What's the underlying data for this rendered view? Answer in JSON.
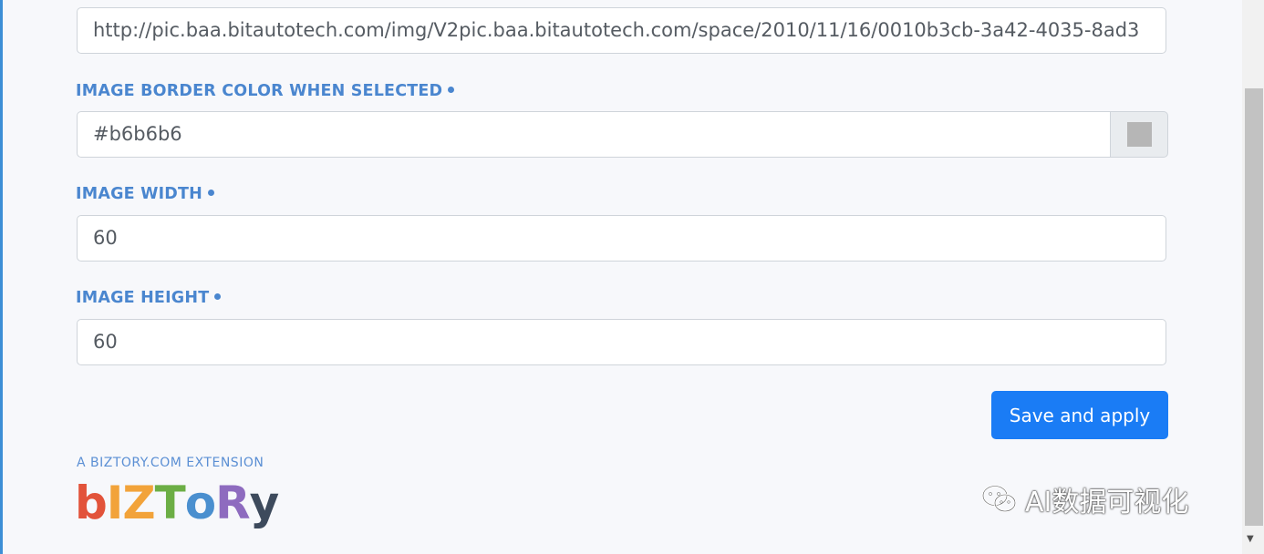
{
  "form": {
    "image_url": {
      "value": "http://pic.baa.bitautotech.com/img/V2pic.baa.bitautotech.com/space/2010/11/16/0010b3cb-3a42-4035-8ad3"
    },
    "border_color": {
      "label": "IMAGE BORDER COLOR WHEN SELECTED",
      "value": "#b6b6b6",
      "swatch_color": "#b6b6b6"
    },
    "image_width": {
      "label": "IMAGE WIDTH",
      "value": "60"
    },
    "image_height": {
      "label": "IMAGE HEIGHT",
      "value": "60"
    },
    "save_button": "Save and apply"
  },
  "footer": {
    "extension_text": "A BIZTORY.COM EXTENSION",
    "logo_text": "bIZToRy",
    "logo_letters": [
      {
        "char": "b",
        "color": "#e2533a"
      },
      {
        "char": "I",
        "color": "#f2a33a"
      },
      {
        "char": "Z",
        "color": "#f2a33a"
      },
      {
        "char": "T",
        "color": "#6cae45"
      },
      {
        "char": "o",
        "color": "#4a8fcf"
      },
      {
        "char": "R",
        "color": "#8e6bbf"
      },
      {
        "char": "y",
        "color": "#3d4a5c"
      }
    ]
  },
  "watermark": {
    "icon": "wechat-icon",
    "text": "AI数据可视化"
  },
  "colors": {
    "accent": "#1a7cf5",
    "label": "#4a86cf"
  }
}
